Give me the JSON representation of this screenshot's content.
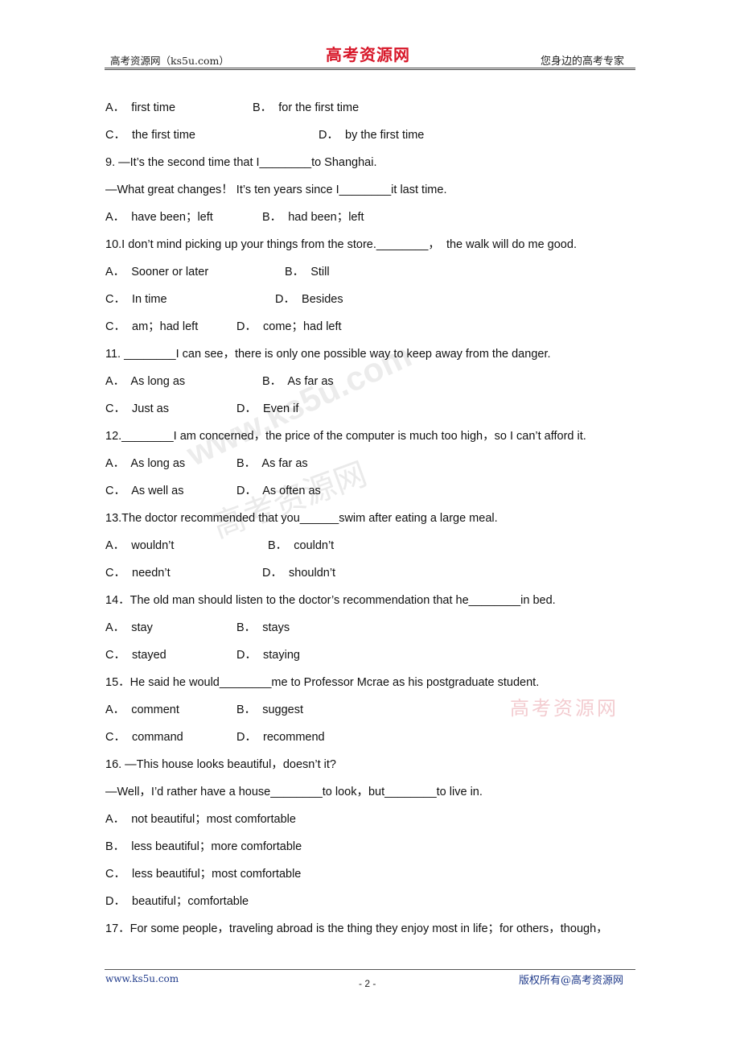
{
  "header": {
    "left": "高考资源网（ks5u.com）",
    "center_logo": "高考资源网",
    "right": "您身边的高考专家"
  },
  "watermarks": {
    "diagonal_url": "www.ks5u.com",
    "diagonal_cn": "高考资源网",
    "stamp": "高考资源网"
  },
  "content": {
    "q8_opts": {
      "a": "A．  first time",
      "b": "B．  for the first time",
      "c": "C．  the first time",
      "d": "D．  by the first time"
    },
    "q9": {
      "stem1": "9. —It’s the second time that I________to Shanghai.",
      "stem2": "—What great changes！ It’s ten years since I________it last time.",
      "a": "A．  have been；left",
      "b": "B．  had been；left",
      "c": "C．  am；had left",
      "d": "D．  come；had left"
    },
    "q10": {
      "stem": "10.I don’t mind picking up your things from the store.________，  the walk will do me good.",
      "a": "A．  Sooner or later",
      "b": "B．  Still",
      "c": "C．  In time",
      "d": "D．  Besides"
    },
    "q11": {
      "stem": "11. ________I can see，there is only one possible way to keep away from the danger.",
      "a": "A．  As long as",
      "b": "B．  As far as",
      "c": "C．  Just as",
      "d": "D．  Even if"
    },
    "q12": {
      "stem": "12.________I am concerned，the price of the computer is much too high，so I can’t afford it.",
      "a": "A．  As long as",
      "b": "B．  As far as",
      "c": "C．  As well as",
      "d": "D．  As often as"
    },
    "q13": {
      "stem": "13.The doctor recommended that you______swim after eating a large meal.",
      "a": "A．  wouldn’t",
      "b": "B．  couldn’t",
      "c": "C．  needn’t",
      "d": "D．  shouldn’t"
    },
    "q14": {
      "stem": "14．The old man should listen to the doctor’s recommendation that he________in bed.",
      "a": "A．  stay",
      "b": "B．  stays",
      "c": "C．  stayed",
      "d": "D．  staying"
    },
    "q15": {
      "stem": "15．He said he would________me to Professor Mcrae as his postgraduate student.",
      "a": "A．  comment",
      "b": "B．  suggest",
      "c": "C．  command",
      "d": "D．  recommend"
    },
    "q16": {
      "stem1": "16. —This house looks beautiful，doesn’t it?",
      "stem2": "—Well，I’d rather have a house________to look，but________to live in.",
      "a": "A．  not beautiful；most comfortable",
      "b": "B．  less beautiful；more comfortable",
      "c": "C．  less beautiful；most comfortable",
      "d": "D．  beautiful；comfortable"
    },
    "q17": {
      "stem": "17．For some people，traveling abroad is the thing they enjoy most in life；for others，though，"
    }
  },
  "footer": {
    "left": "www.ks5u.com",
    "page": "- 2 -",
    "right": "版权所有@高考资源网"
  }
}
